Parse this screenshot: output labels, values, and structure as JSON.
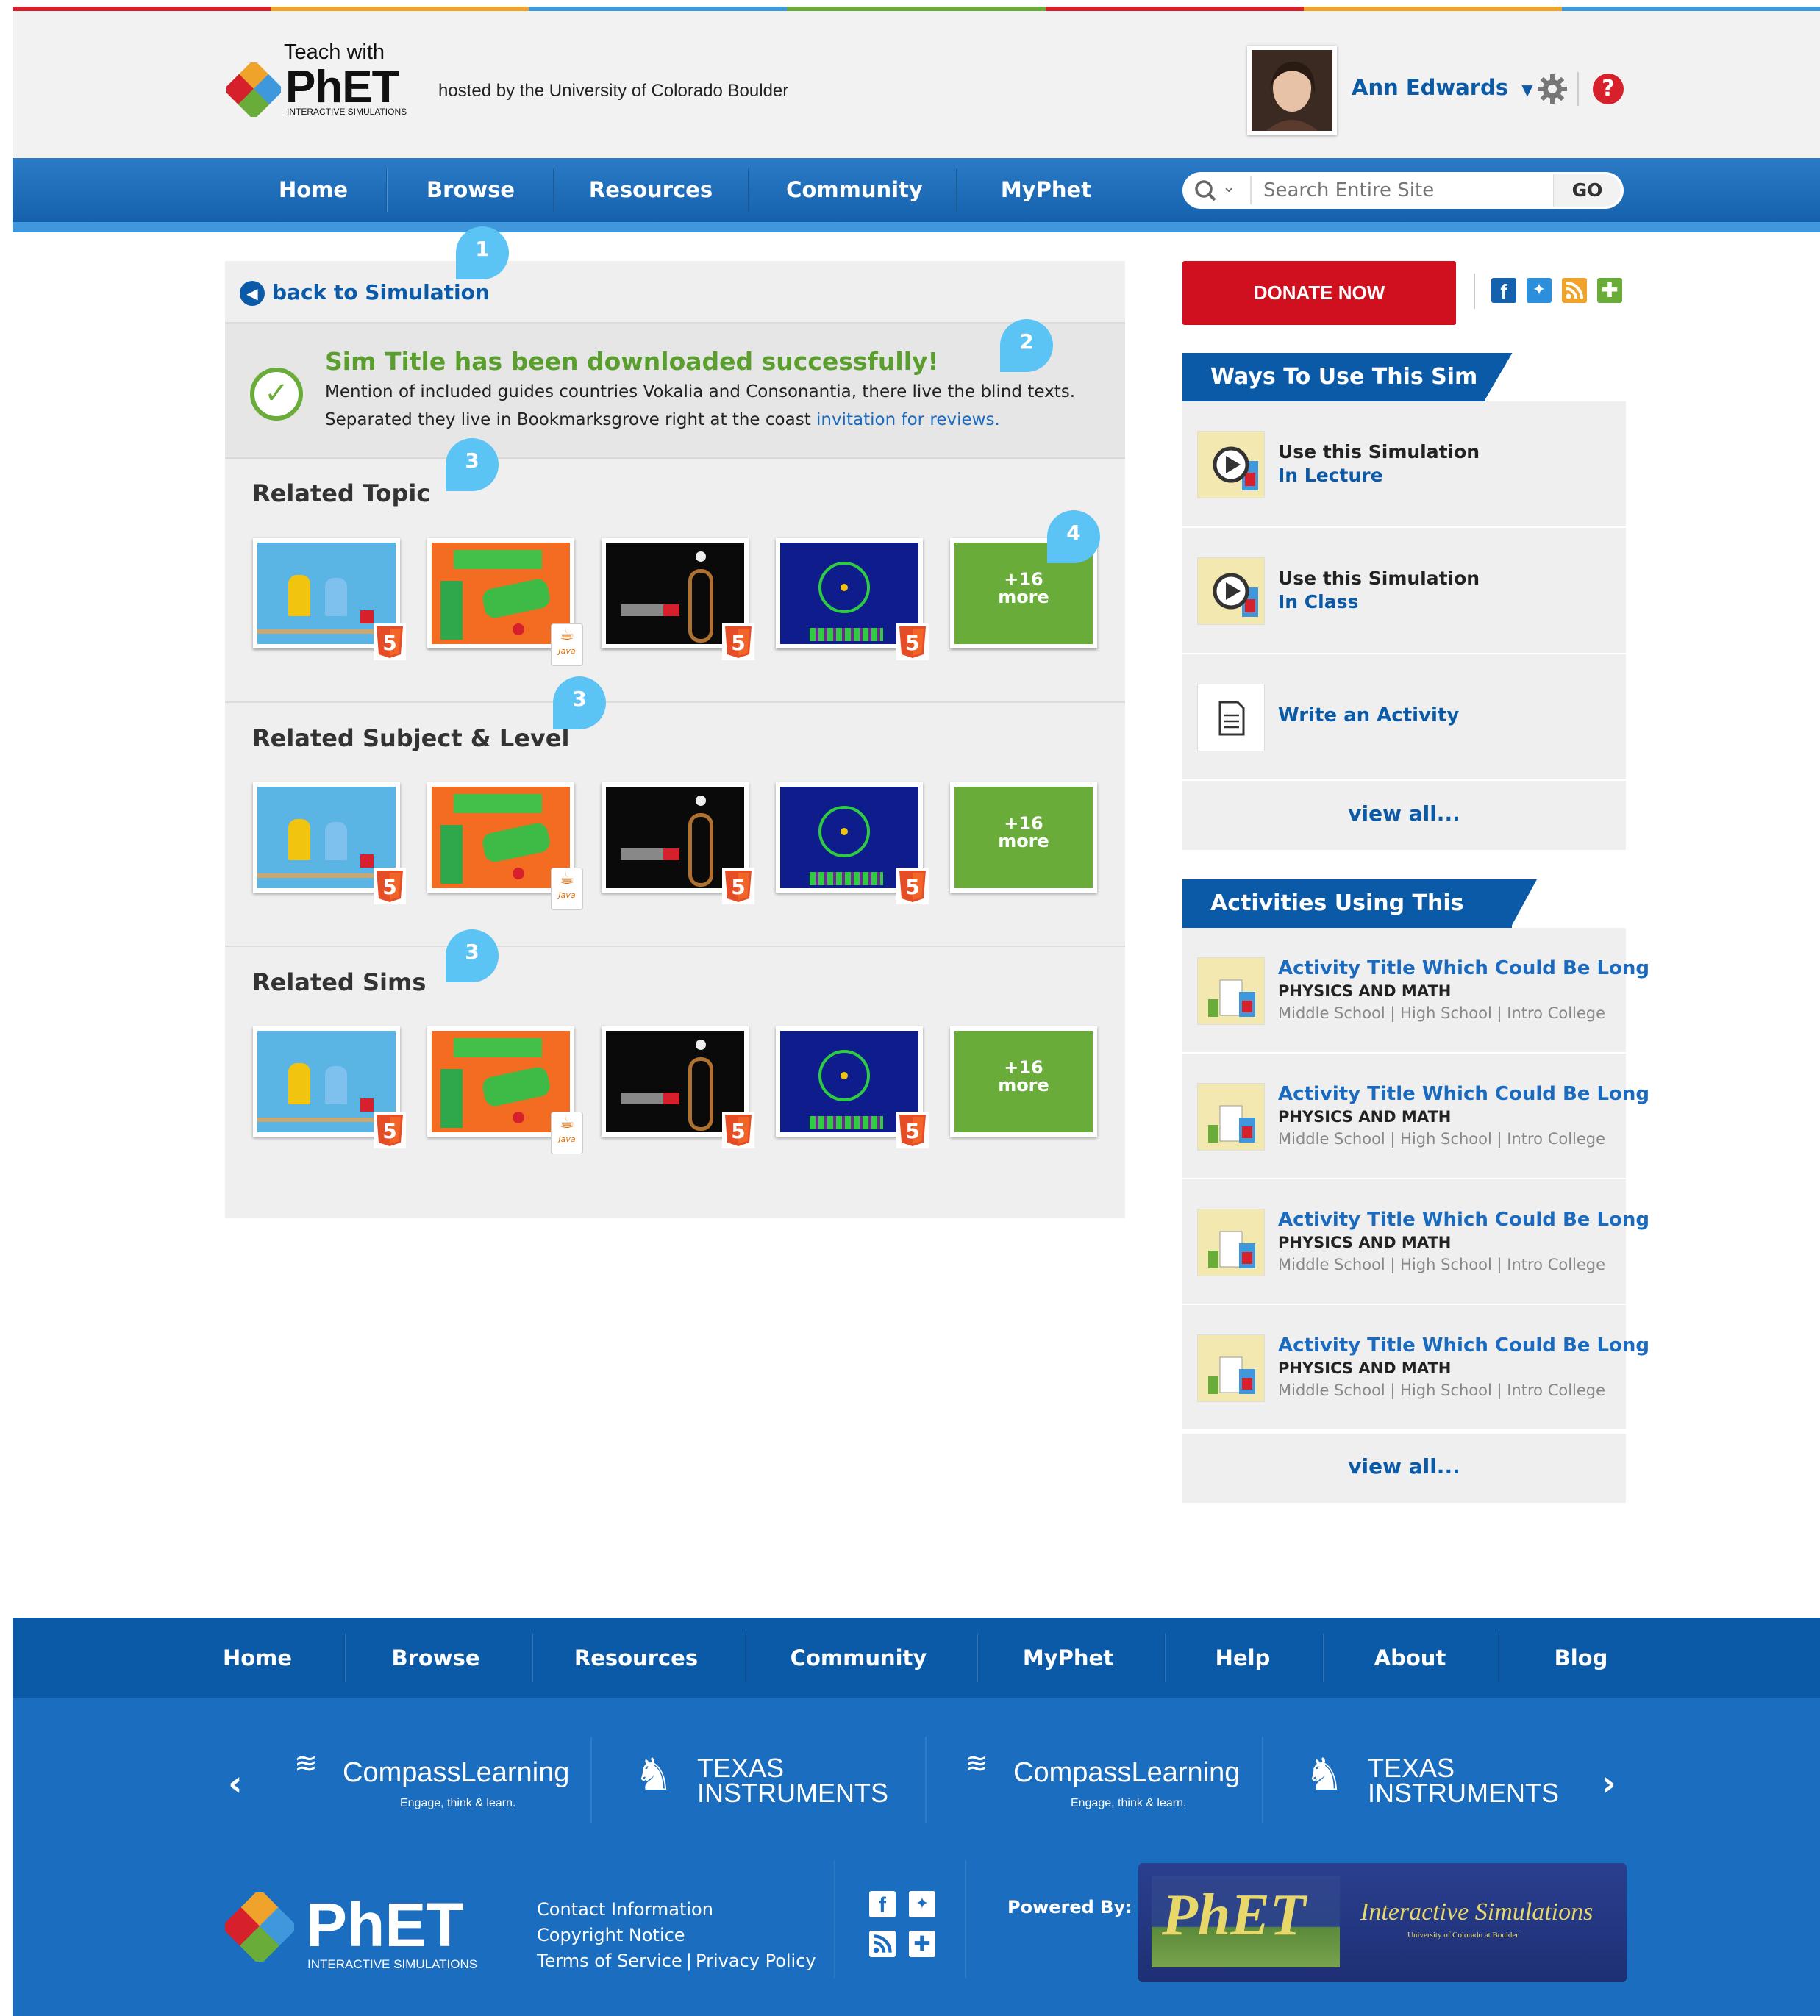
{
  "header": {
    "logo_teach": "Teach with",
    "logo_phet": "PhET",
    "logo_sub": "INTERACTIVE SIMULATIONS",
    "hosted_by": "hosted by the University of Colorado Boulder",
    "user_name": "Ann Edwards",
    "stripe_colors": [
      "#d6202c",
      "#f0a32a",
      "#3f97dc",
      "#6aac3a",
      "#d6202c",
      "#f0a32a",
      "#3f97dc"
    ]
  },
  "nav": {
    "items": [
      "Home",
      "Browse",
      "Resources",
      "Community",
      "MyPhet"
    ],
    "search_placeholder": "Search Entire Site",
    "go_label": "GO"
  },
  "main": {
    "back_label": "back to Simulation",
    "success_title": "Sim Title has been downloaded successfully!",
    "success_text_1": "Mention of included guides countries Vokalia and Consonantia, there live the blind texts.",
    "success_text_2": "Separated they live in Bookmarksgrove right at the coast",
    "success_link": "invitation for reviews.",
    "sections": [
      {
        "title": "Related Topic",
        "more_count": "+16",
        "more_label": "more"
      },
      {
        "title": "Related Subject & Level",
        "more_count": "+16",
        "more_label": "more"
      },
      {
        "title": "Related Sims",
        "more_count": "+16",
        "more_label": "more"
      }
    ],
    "callouts": [
      "1",
      "2",
      "3",
      "3",
      "3",
      "4"
    ],
    "java_label": "Java",
    "h5_label": "5"
  },
  "sidebar": {
    "donate_label": "DONATE NOW",
    "ways_title": "Ways To Use This Sim",
    "ways": [
      {
        "line1": "Use this Simulation",
        "line2": "In Lecture"
      },
      {
        "line1": "Use this Simulation",
        "line2": "In Class"
      }
    ],
    "write_activity": "Write an Activity",
    "view_all": "view all...",
    "activities_title": "Activities Using This Sim",
    "activities": [
      {
        "title": "Activity Title Which Could Be Long",
        "subject": "PHYSICS AND MATH",
        "levels": [
          "Middle School",
          "High School",
          "Intro College"
        ]
      },
      {
        "title": "Activity Title Which Could Be Long",
        "subject": "PHYSICS AND MATH",
        "levels": [
          "Middle School",
          "High School",
          "Intro College"
        ]
      },
      {
        "title": "Activity Title Which Could Be Long",
        "subject": "PHYSICS AND MATH",
        "levels": [
          "Middle School",
          "High School",
          "Intro College"
        ]
      },
      {
        "title": "Activity Title Which Could Be Long",
        "subject": "PHYSICS AND MATH",
        "levels": [
          "Middle School",
          "High School",
          "Intro College"
        ]
      }
    ],
    "level_sep": "|"
  },
  "footer": {
    "nav": [
      "Home",
      "Browse",
      "Resources",
      "Community",
      "MyPhet",
      "Help",
      "About",
      "Blog"
    ],
    "sponsors": [
      {
        "name": "CompassLearning",
        "tagline": "Engage, think & learn."
      },
      {
        "name": "TEXAS INSTRUMENTS"
      },
      {
        "name": "CompassLearning",
        "tagline": "Engage, think & learn."
      },
      {
        "name": "TEXAS INSTRUMENTS"
      }
    ],
    "links": [
      "Contact Information",
      "Copyright Notice",
      "Terms of Service",
      "Privacy Policy"
    ],
    "link_sep": "|",
    "powered_by": "Powered By:",
    "banner_phet": "PhET",
    "banner_title": "Interactive Simulations",
    "banner_sub": "University of Colorado at Boulder",
    "logo_phet": "PhET",
    "logo_sub": "INTERACTIVE SIMULATIONS"
  }
}
